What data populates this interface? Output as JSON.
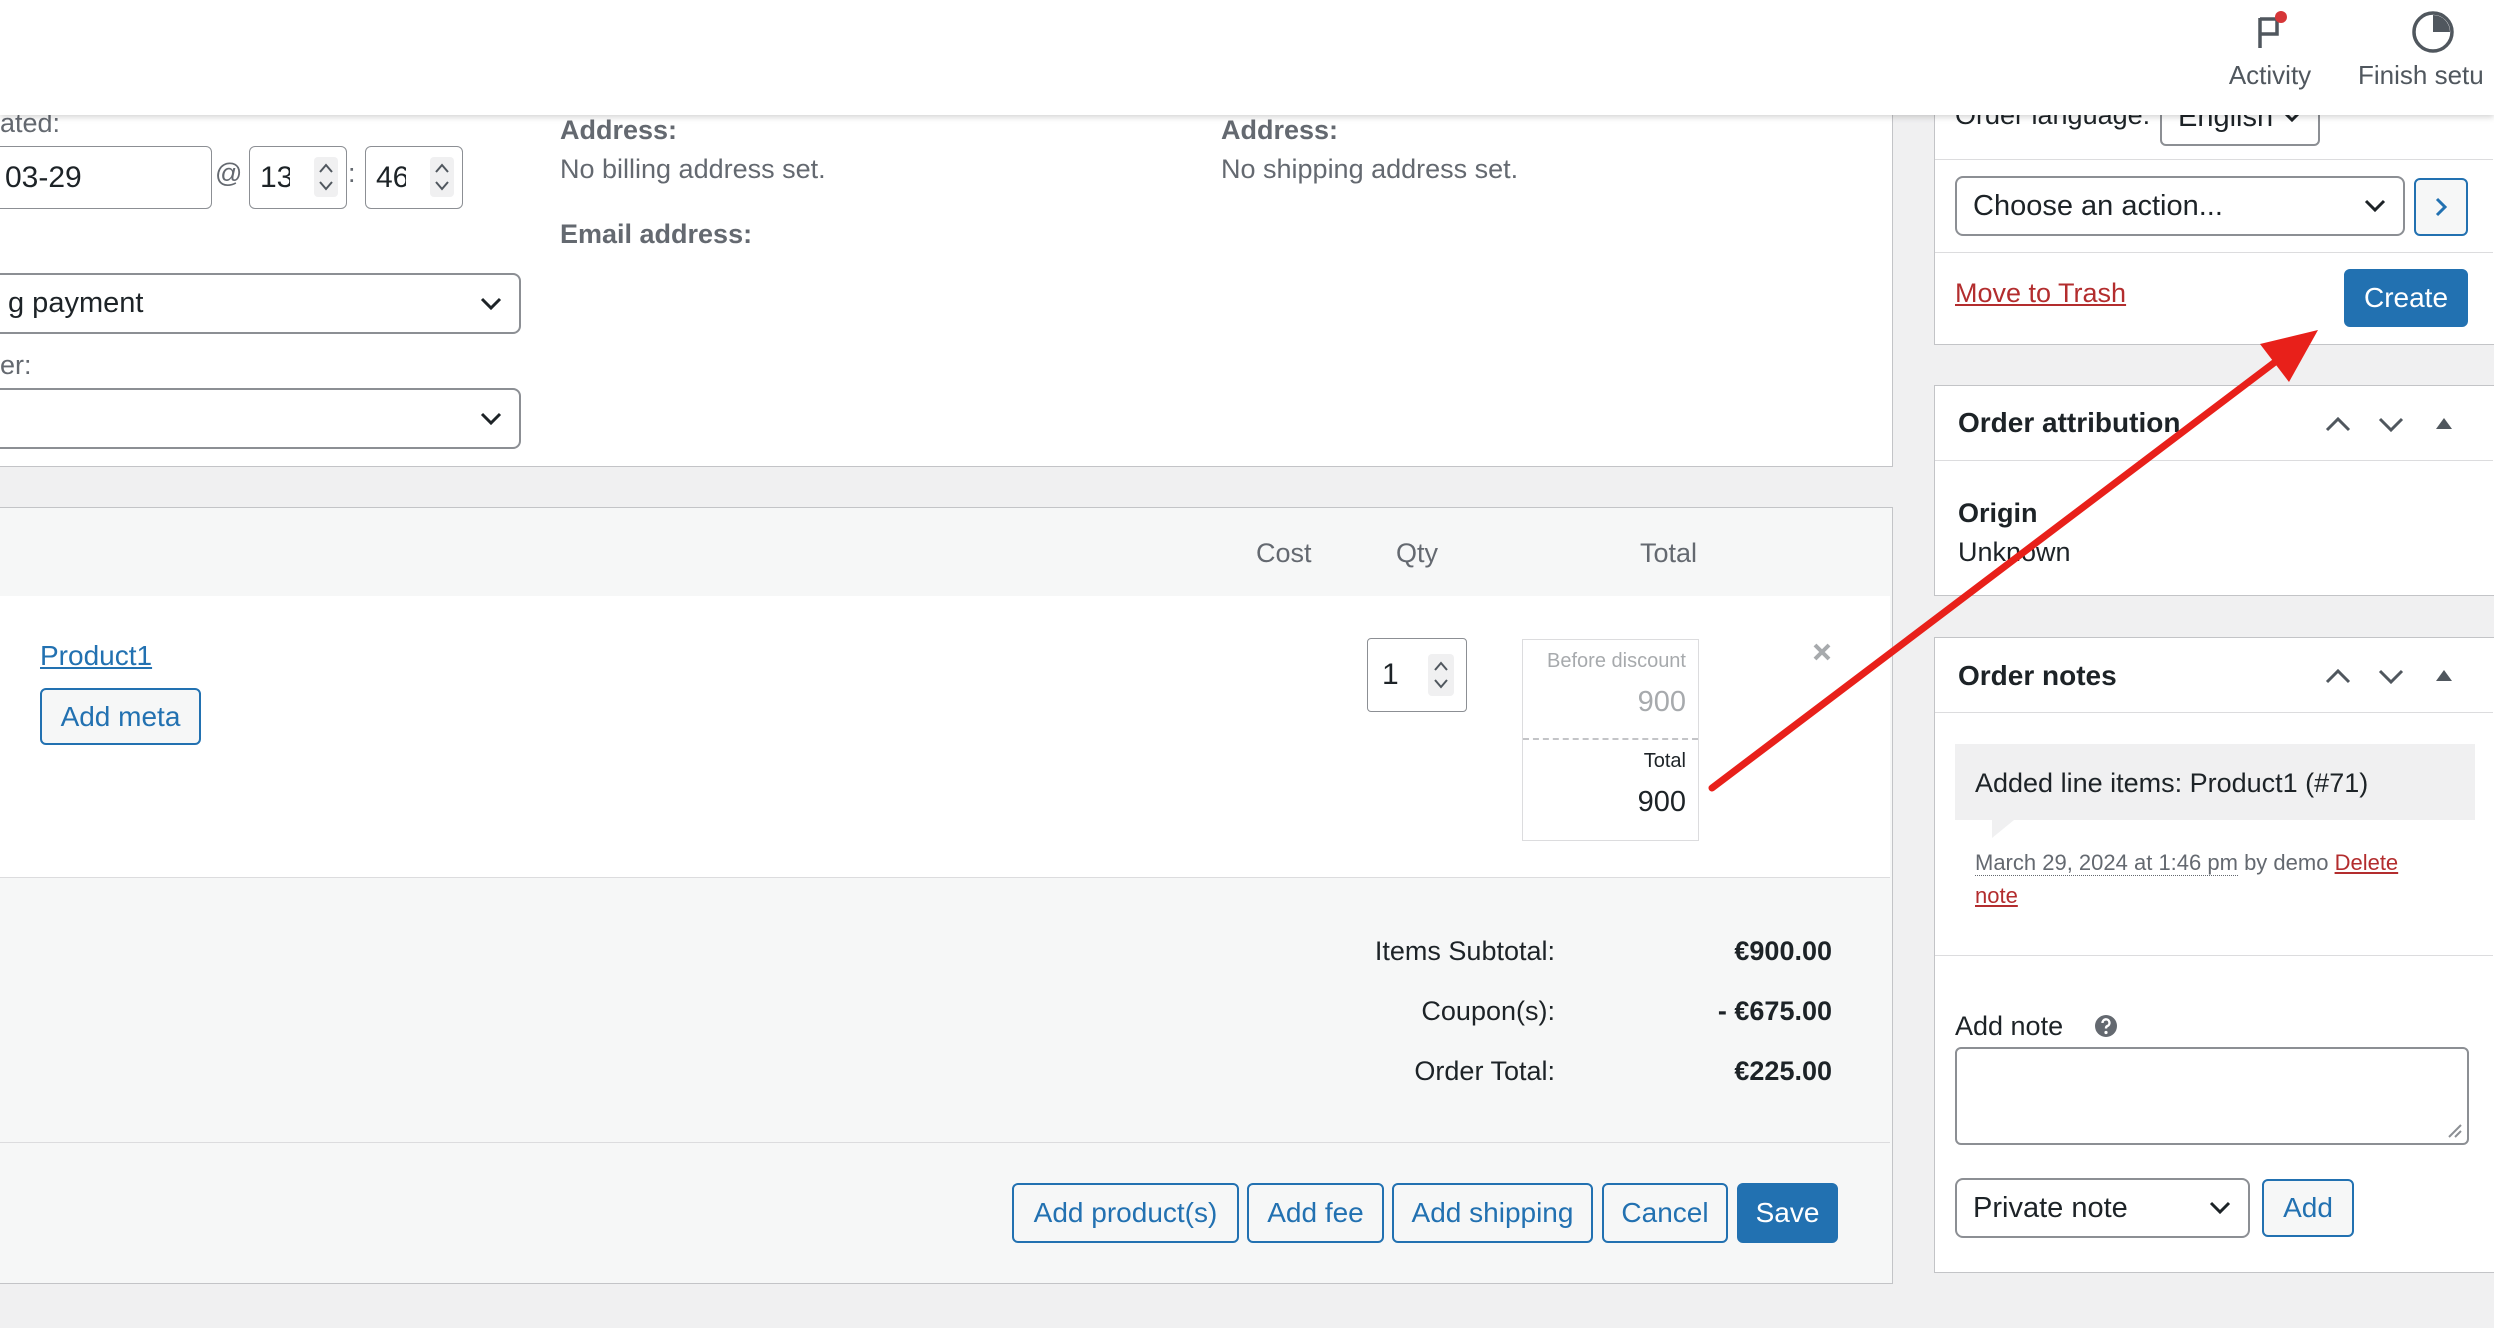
{
  "topbar": {
    "activity_label": "Activity",
    "finish_setup_label": "Finish setu"
  },
  "order_details": {
    "date_created_label": "ated:",
    "date_value": "03-29",
    "at_sign": "@",
    "hour_value": "13",
    "time_sep": ":",
    "minute_value": "46",
    "status_value": "g payment",
    "customer_label": "er:",
    "customer_value": ""
  },
  "billing": {
    "address_label": "Address:",
    "address_value": "No billing address set.",
    "email_label": "Email address:"
  },
  "shipping": {
    "address_label": "Address:",
    "address_value": "No shipping address set."
  },
  "items": {
    "headers": {
      "cost": "Cost",
      "qty": "Qty",
      "total": "Total"
    },
    "rows": [
      {
        "product": "Product1",
        "add_meta": "Add meta",
        "qty": "1",
        "before_discount_label": "Before discount",
        "before_discount_value": "900",
        "total_label": "Total",
        "total_value": "900",
        "remove_icon": "close-icon"
      }
    ]
  },
  "totals": {
    "subtotal_label": "Items Subtotal:",
    "subtotal_value": "€900.00",
    "coupons_label": "Coupon(s):",
    "coupons_value": "- €675.00",
    "order_total_label": "Order Total:",
    "order_total_value": "€225.00"
  },
  "actions": {
    "add_products": "Add product(s)",
    "add_fee": "Add fee",
    "add_shipping": "Add shipping",
    "cancel": "Cancel",
    "save": "Save"
  },
  "order_actions": {
    "language_label": "Order language:",
    "language_value": "English",
    "choose_action": "Choose an action...",
    "move_to_trash": "Move to Trash",
    "create": "Create"
  },
  "order_attribution": {
    "title": "Order attribution",
    "origin_label": "Origin",
    "origin_value": "Unknown"
  },
  "order_notes": {
    "title": "Order notes",
    "note_text": "Added line items: Product1 (#71)",
    "note_date": "March 29, 2024 at 1:46 pm",
    "note_by": "by demo",
    "delete_note_1": "Delete",
    "delete_note_2": "note",
    "add_note_label": "Add note",
    "help_icon": "question-icon",
    "note_type_value": "Private note",
    "add_button": "Add"
  },
  "colors": {
    "accent": "#2271b1",
    "danger": "#b32d2e",
    "annotation_arrow": "#e8201a"
  }
}
